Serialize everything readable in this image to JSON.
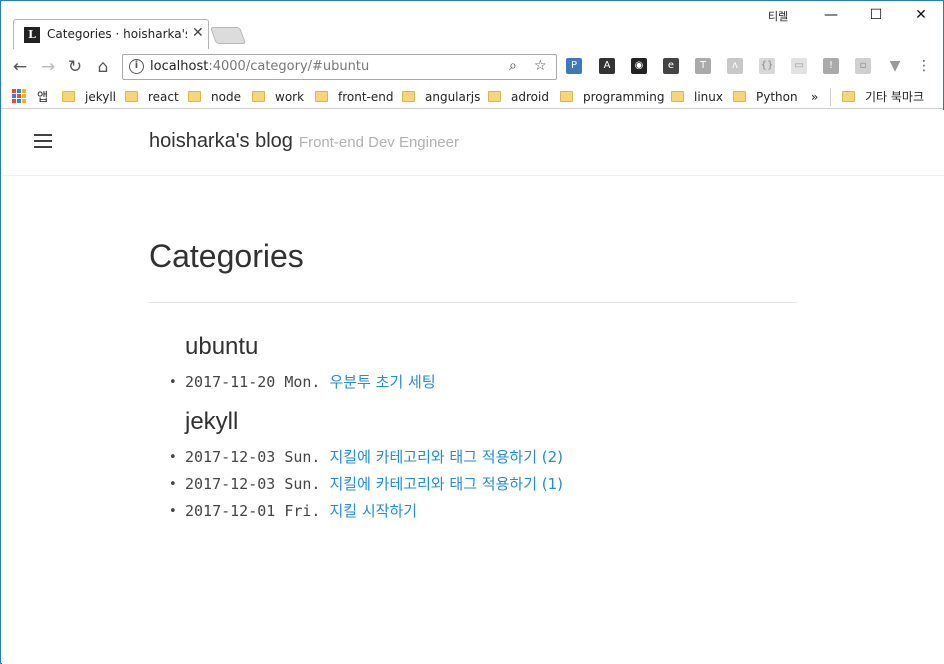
{
  "browser": {
    "tab_title": "Categories · hoisharka's blog",
    "tab_favicon": "L",
    "window_user": "티렐",
    "url_host": "localhost",
    "url_path": ":4000/category/#ubuntu",
    "bookmarks": {
      "apps_label": "앱",
      "items": [
        "jekyll",
        "react",
        "node",
        "work",
        "front-end",
        "angularjs",
        "adroid",
        "programming",
        "linux",
        "Python"
      ],
      "overflow": "»",
      "other_label": "기타 북마크"
    }
  },
  "site": {
    "title": "hoisharka's blog",
    "tagline": "Front-end Dev Engineer"
  },
  "page": {
    "title": "Categories",
    "categories": [
      {
        "name": "ubuntu",
        "posts": [
          {
            "date": "2017-11-20 Mon.",
            "title": "우분투 초기 세팅"
          }
        ]
      },
      {
        "name": "jekyll",
        "posts": [
          {
            "date": "2017-12-03 Sun.",
            "title": "지킬에 카테고리와 태그 적용하기 (2)"
          },
          {
            "date": "2017-12-03 Sun.",
            "title": "지킬에 카테고리와 태그 적용하기 (1)"
          },
          {
            "date": "2017-12-01 Fri.",
            "title": "지킬 시작하기"
          }
        ]
      }
    ]
  },
  "colors": {
    "link": "#268bd2",
    "text": "#313131",
    "tagline": "#b0b0b0",
    "window_border": "#2b79c2"
  }
}
